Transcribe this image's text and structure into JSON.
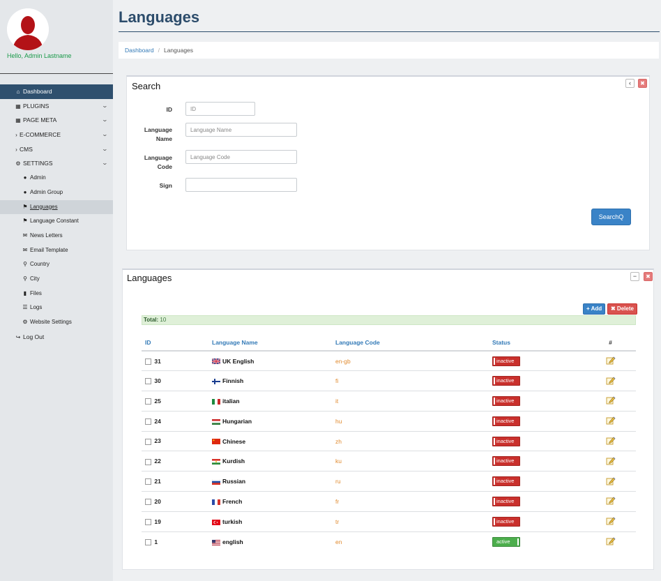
{
  "sidebar": {
    "greeting": "Hello, Admin Lastname",
    "items": [
      {
        "label": "Dashboard",
        "icon": "home-icon"
      },
      {
        "label": "PLUGINS",
        "icon": "table-icon"
      },
      {
        "label": "PAGE META",
        "icon": "table-icon"
      },
      {
        "label": "E-COMMERCE",
        "icon": "chevron-right-icon"
      },
      {
        "label": "CMS",
        "icon": "chevron-right-icon"
      },
      {
        "label": "SETTINGS",
        "icon": "gear-icon"
      },
      {
        "label": "Admin",
        "icon": "user-icon"
      },
      {
        "label": "Admin Group",
        "icon": "user-icon"
      },
      {
        "label": "Languages",
        "icon": "flag-icon"
      },
      {
        "label": "Language Constant",
        "icon": "flag-icon"
      },
      {
        "label": "News Letters",
        "icon": "envelope-icon"
      },
      {
        "label": "Email Template",
        "icon": "envelope-icon"
      },
      {
        "label": "Country",
        "icon": "map-marker-icon"
      },
      {
        "label": "City",
        "icon": "map-marker-icon"
      },
      {
        "label": "Files",
        "icon": "file-icon"
      },
      {
        "label": "Logs",
        "icon": "list-icon"
      },
      {
        "label": "Website Settings",
        "icon": "gear-icon"
      },
      {
        "label": "Log Out",
        "icon": "logout-icon"
      }
    ]
  },
  "header": {
    "title": "Languages",
    "breadcrumb": {
      "home": "Dashboard",
      "current": "Languages"
    }
  },
  "search": {
    "title": "Search",
    "fields": {
      "id": {
        "label": "ID",
        "placeholder": "ID",
        "value": ""
      },
      "name": {
        "label_line1": "Language",
        "label_line2": "Name",
        "placeholder": "Language Name",
        "value": ""
      },
      "code": {
        "label_line1": "Language",
        "label_line2": "Code",
        "placeholder": "Language Code",
        "value": ""
      },
      "sign": {
        "label": "Sign",
        "placeholder": "",
        "value": ""
      }
    },
    "button": "SearchQ"
  },
  "results": {
    "title": "Languages",
    "add_label": "+ Add",
    "delete_label": "✖ Delete",
    "total_label": "Total:",
    "total_value": "10",
    "columns": {
      "id": "ID",
      "name": "Language Name",
      "code": "Language Code",
      "status": "Status",
      "actions": "#"
    },
    "rows": [
      {
        "id": "31",
        "name": "UK English",
        "code": "en-gb",
        "status": "inactive",
        "flag": "uk"
      },
      {
        "id": "30",
        "name": "Finnish",
        "code": "fi",
        "status": "inactive",
        "flag": "fi"
      },
      {
        "id": "25",
        "name": "italian",
        "code": "it",
        "status": "inactive",
        "flag": "it"
      },
      {
        "id": "24",
        "name": "Hungarian",
        "code": "hu",
        "status": "inactive",
        "flag": "hu"
      },
      {
        "id": "23",
        "name": "Chinese",
        "code": "zh",
        "status": "inactive",
        "flag": "cn"
      },
      {
        "id": "22",
        "name": "Kurdish",
        "code": "ku",
        "status": "inactive",
        "flag": "ku"
      },
      {
        "id": "21",
        "name": "Russian",
        "code": "ru",
        "status": "inactive",
        "flag": "ru"
      },
      {
        "id": "20",
        "name": "French",
        "code": "fr",
        "status": "inactive",
        "flag": "fr"
      },
      {
        "id": "19",
        "name": "turkish",
        "code": "tr",
        "status": "inactive",
        "flag": "tr"
      },
      {
        "id": "1",
        "name": "english",
        "code": "en",
        "status": "active",
        "flag": "us"
      }
    ]
  },
  "colors": {
    "sidebar_active": "#2f506e",
    "title": "#2c4c6b",
    "primary": "#3a83c7",
    "danger": "#c9302c",
    "success": "#4cae4c",
    "code": "#e08a2e"
  }
}
